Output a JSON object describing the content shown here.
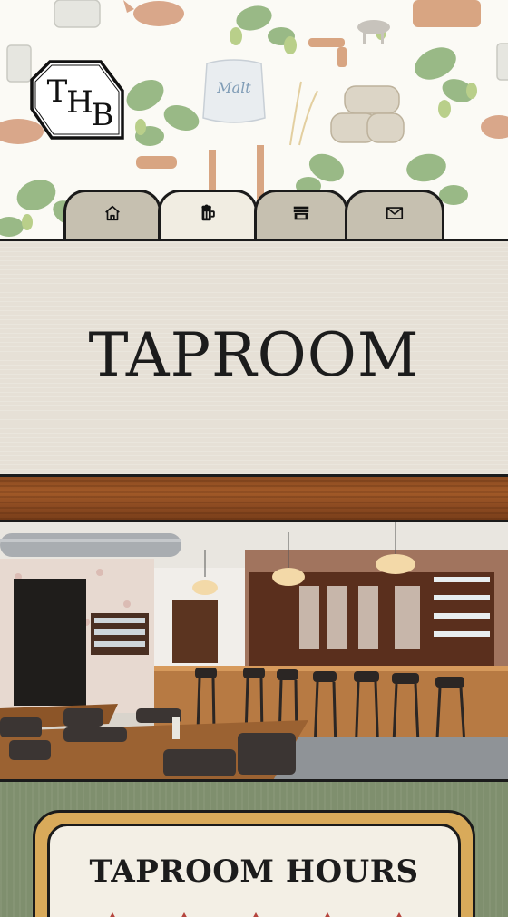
{
  "header": {
    "logo_text": "THB",
    "wallpaper_label": "Malt",
    "tabs": [
      {
        "id": "home",
        "icon": "home-icon",
        "active": false
      },
      {
        "id": "taproom",
        "icon": "beer-mug-icon",
        "active": true
      },
      {
        "id": "shop",
        "icon": "store-icon",
        "active": false
      },
      {
        "id": "contact",
        "icon": "mail-icon",
        "active": false
      }
    ]
  },
  "main": {
    "title": "TAPROOM"
  },
  "hours": {
    "title": "TAPROOM HOURS"
  },
  "colors": {
    "ink": "#1b1b1b",
    "tab_inactive": "#c6c0b0",
    "tab_active": "#f1ede2",
    "title_bg": "#e6e0d6",
    "hours_bg": "#7f8f6e",
    "card_frame": "#d9aa5a",
    "card_bg": "#f3efe5",
    "accent_red": "#b5443c"
  }
}
